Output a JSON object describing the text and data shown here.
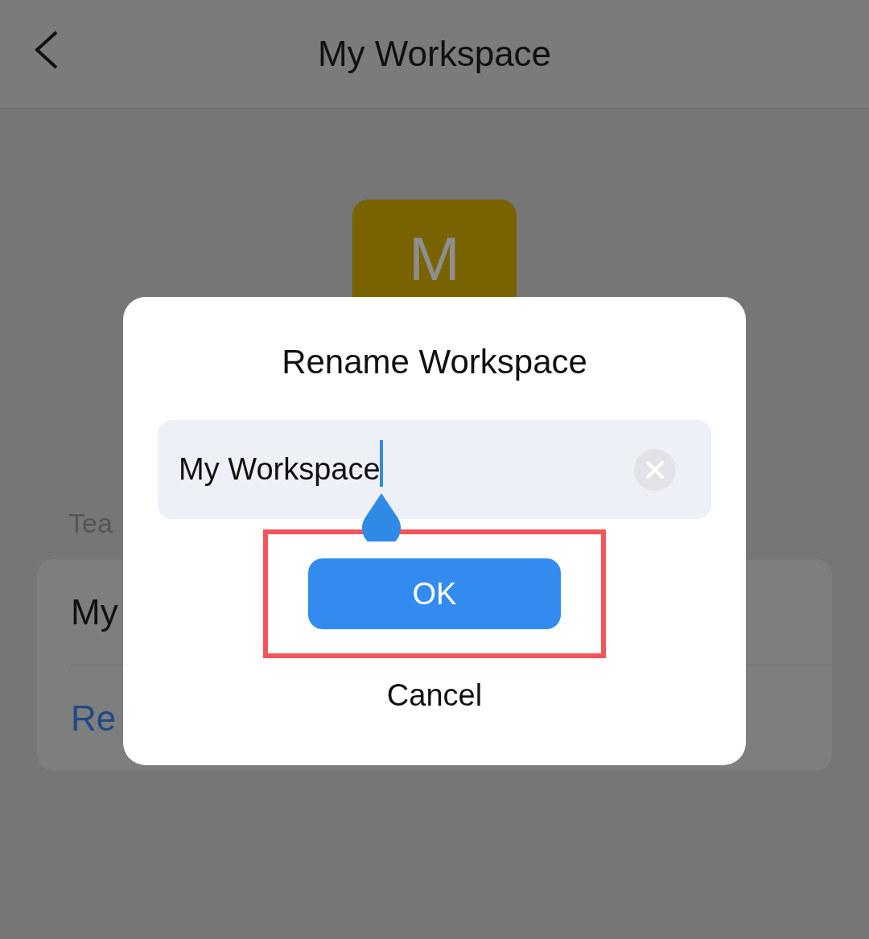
{
  "header": {
    "title": "My Workspace"
  },
  "avatar": {
    "initial": "M"
  },
  "section_label": "Tea",
  "card": {
    "name": "My",
    "action": "Re"
  },
  "dialog": {
    "title": "Rename Workspace",
    "field": {
      "value": "My Workspace",
      "focused": true
    },
    "buttons": [
      {
        "label": "OK",
        "kind": "primary",
        "highlighted": true
      },
      {
        "label": "Cancel",
        "kind": "text",
        "highlighted": false
      }
    ]
  }
}
